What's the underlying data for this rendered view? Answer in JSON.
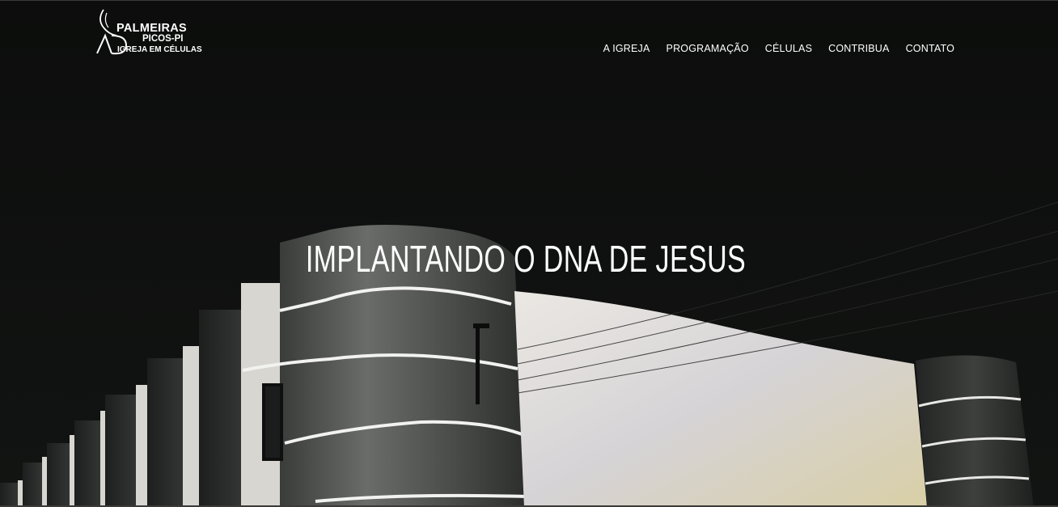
{
  "brand": {
    "line1": "PALMEIRAS",
    "line2": "PICOS-PI",
    "line3": "IGREJA EM CÉLULAS",
    "mark": "AD",
    "icon": "flame-icon"
  },
  "nav": {
    "items": [
      {
        "label": "A IGREJA"
      },
      {
        "label": "PROGRAMAÇÃO"
      },
      {
        "label": "CÉLULAS"
      },
      {
        "label": "CONTRIBUA"
      },
      {
        "label": "CONTATO"
      }
    ]
  },
  "hero": {
    "title": "IMPLANTANDO O DNA DE JESUS"
  },
  "colors": {
    "background": "#0a0b0a",
    "text": "#ffffff",
    "wall_light": "#d8d6d0",
    "wall_dark": "#1f2220"
  }
}
